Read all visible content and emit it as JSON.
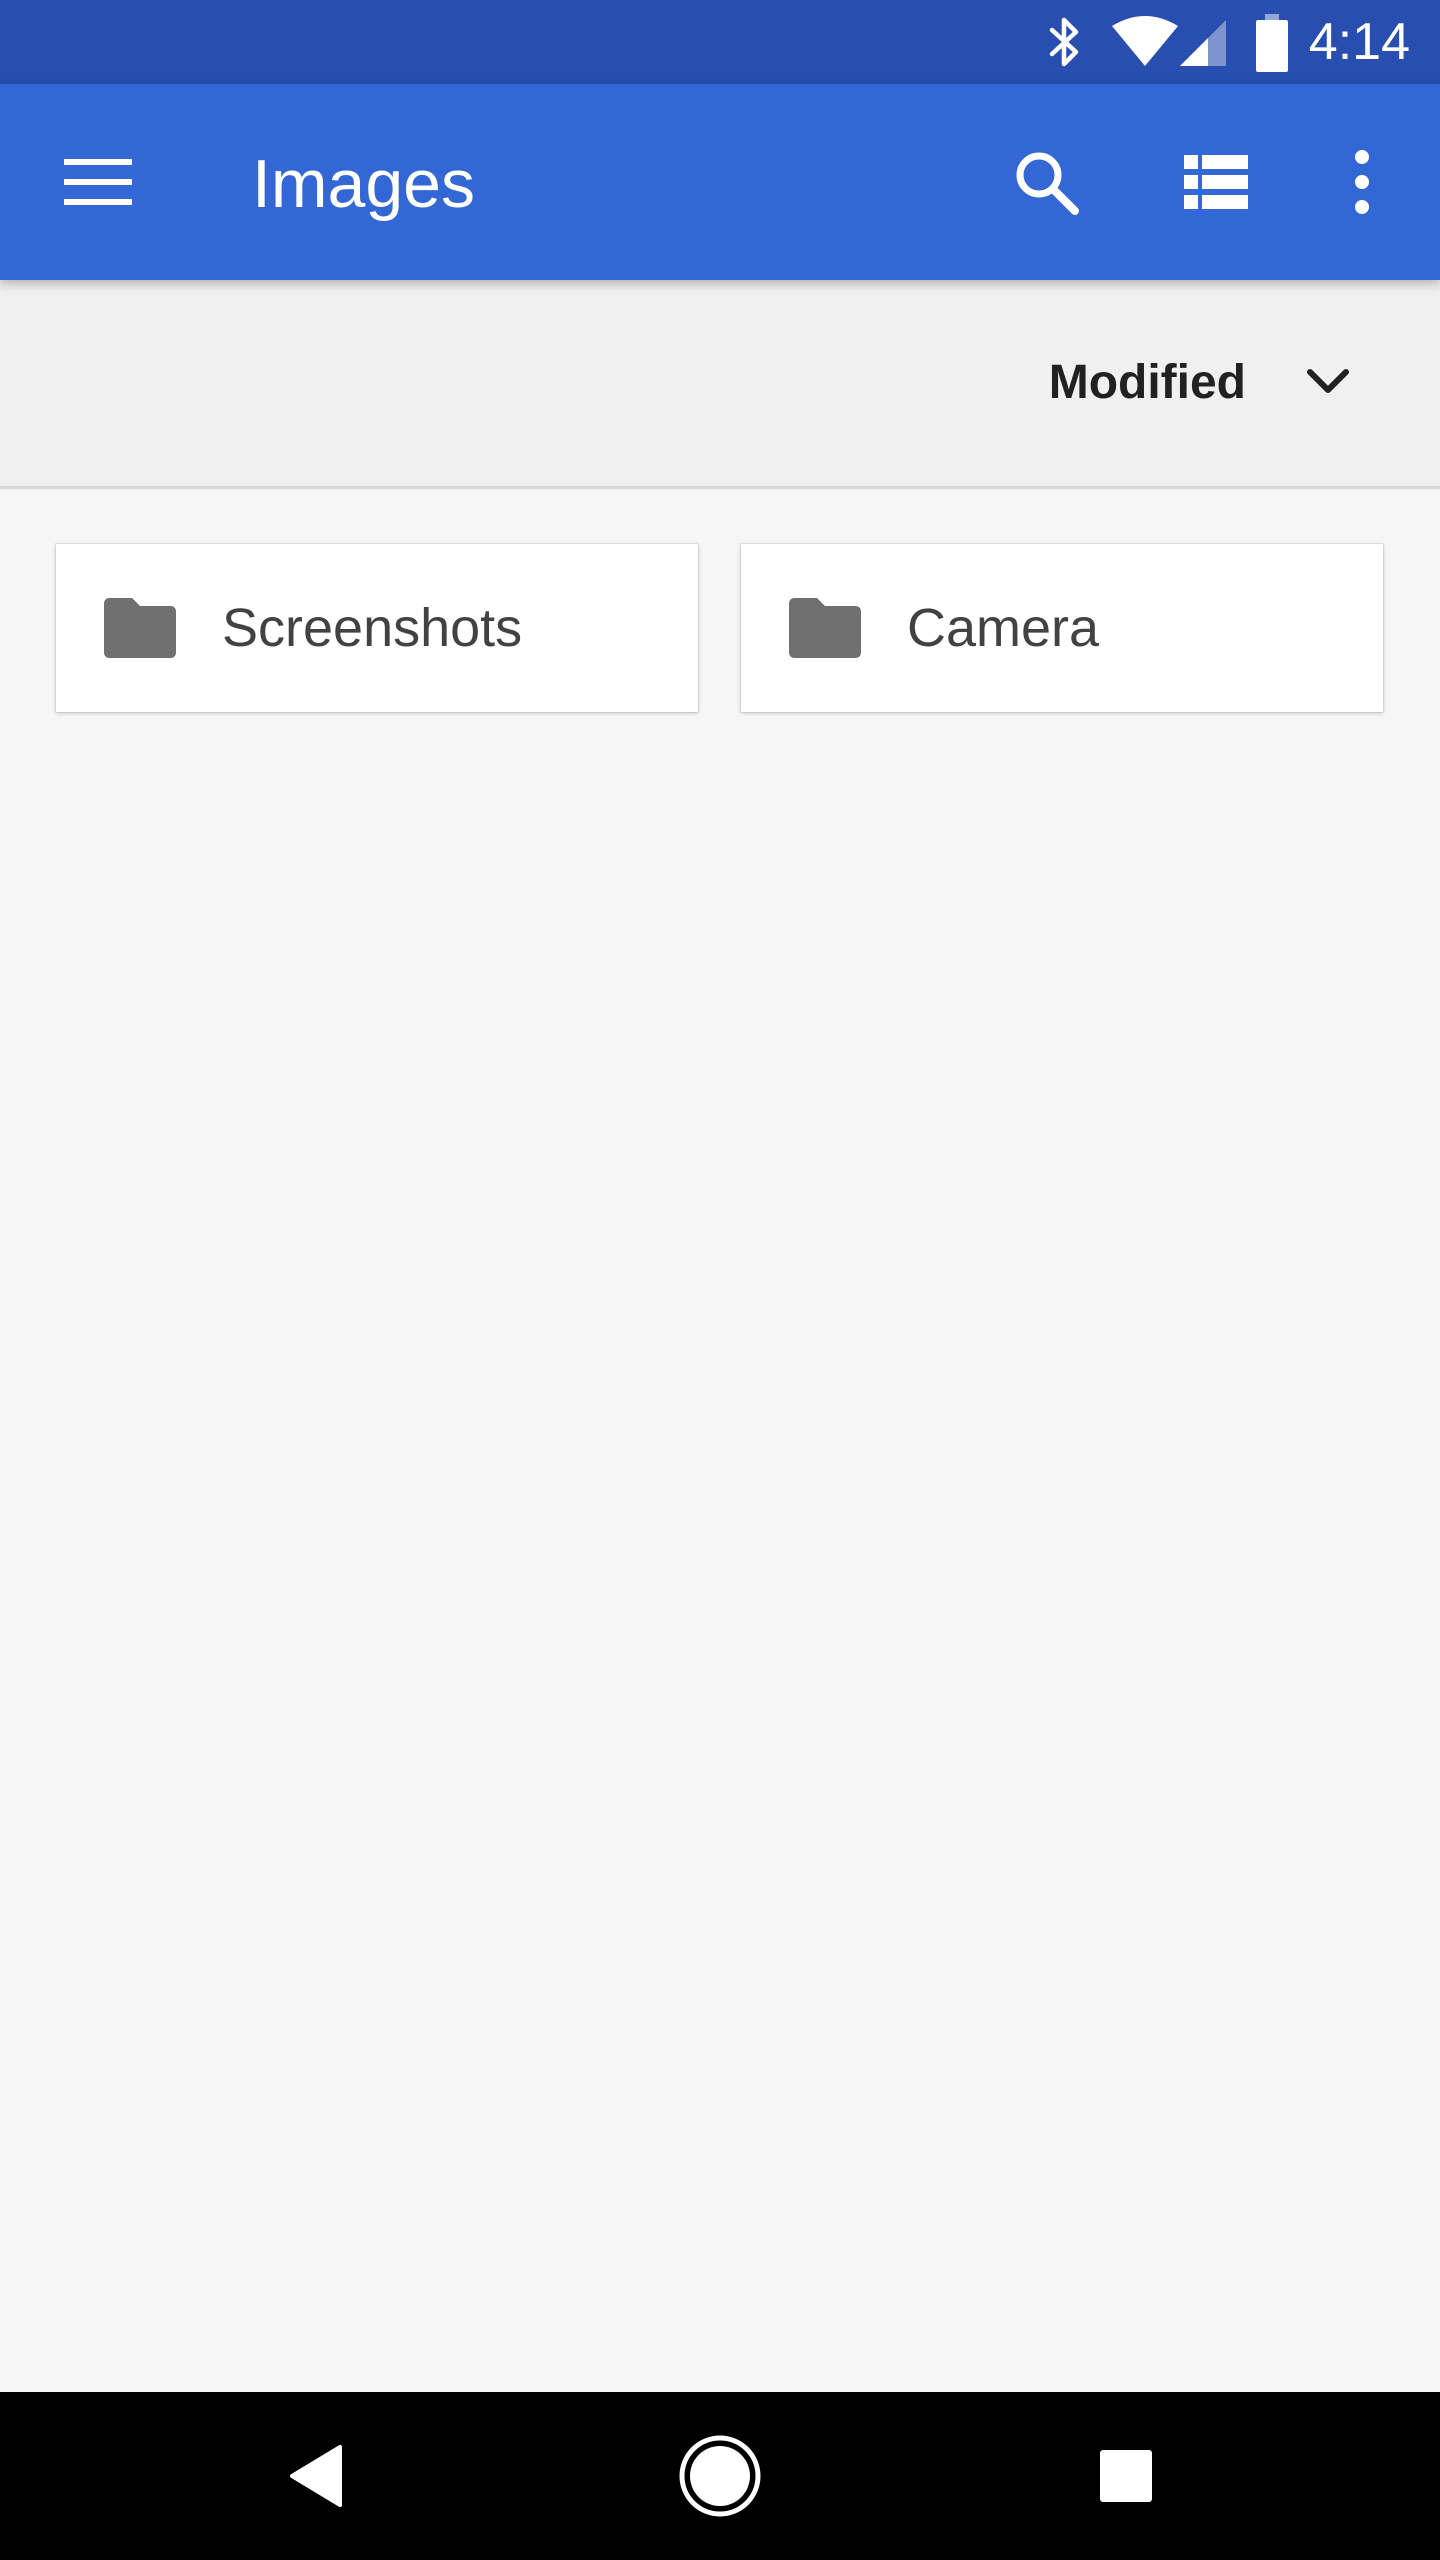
{
  "status_bar": {
    "time": "4:14",
    "icons": [
      "bluetooth-icon",
      "wifi-icon",
      "signal-icon",
      "battery-icon"
    ]
  },
  "app_bar": {
    "title": "Images",
    "icons": [
      "menu-icon",
      "search-icon",
      "list-view-icon",
      "more-vert-icon"
    ],
    "color": "#3367d6"
  },
  "sort": {
    "label": "Modified",
    "icon": "chevron-down-icon"
  },
  "folders": [
    {
      "name": "Screenshots",
      "icon": "folder-icon"
    },
    {
      "name": "Camera",
      "icon": "folder-icon"
    }
  ],
  "nav_bar": {
    "icons": [
      "back-icon",
      "home-icon",
      "recents-icon"
    ]
  },
  "colors": {
    "status_bar": "#284eb0",
    "app_bar": "#3367d6",
    "background": "#f6f6f6",
    "sort_bar": "#f0f0f0",
    "folder_icon": "#6f6f6f"
  }
}
